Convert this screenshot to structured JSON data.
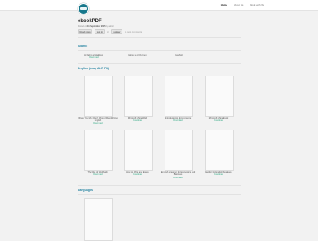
{
  "nav": {
    "items": [
      "Home",
      "About Us",
      "Work with Us"
    ]
  },
  "post": {
    "title": "ebookPDF",
    "meta_posted": "Posted on",
    "meta_date": "11 September 2015",
    "meta_by": "by",
    "meta_author": "admin",
    "read_more": "Read more",
    "login": "Log in",
    "or": "or",
    "register": "register",
    "comments": "to post comments"
  },
  "sections": {
    "islamic": {
      "title": "Islamic",
      "books": [
        {
          "title": "Al Rahiq al Makhtum",
          "download": "Download"
        },
        {
          "title": "Hikmat e Al Qurraan",
          "download": ""
        },
        {
          "title": "Qashqol",
          "download": ""
        }
      ]
    },
    "english": {
      "title": "English (Aray ALIT FB)",
      "books": [
        {
          "title": "Where You May Don't Wrong When Writing English",
          "download": "Download"
        },
        {
          "title": "Microsoft office Word",
          "download": "Download"
        },
        {
          "title": "Introduction to E-Commerce",
          "download": "Download"
        },
        {
          "title": "Microsoft office Excel",
          "download": "Download"
        },
        {
          "title": "The Diet of Web habit",
          "download": "Download"
        },
        {
          "title": "How to Write and Essay",
          "download": "Download"
        },
        {
          "title": "English Grammar for Economics and Business",
          "download": "Download"
        },
        {
          "title": "English for English Speakers",
          "download": "Download"
        }
      ]
    },
    "languages": {
      "title": "Languages"
    }
  }
}
